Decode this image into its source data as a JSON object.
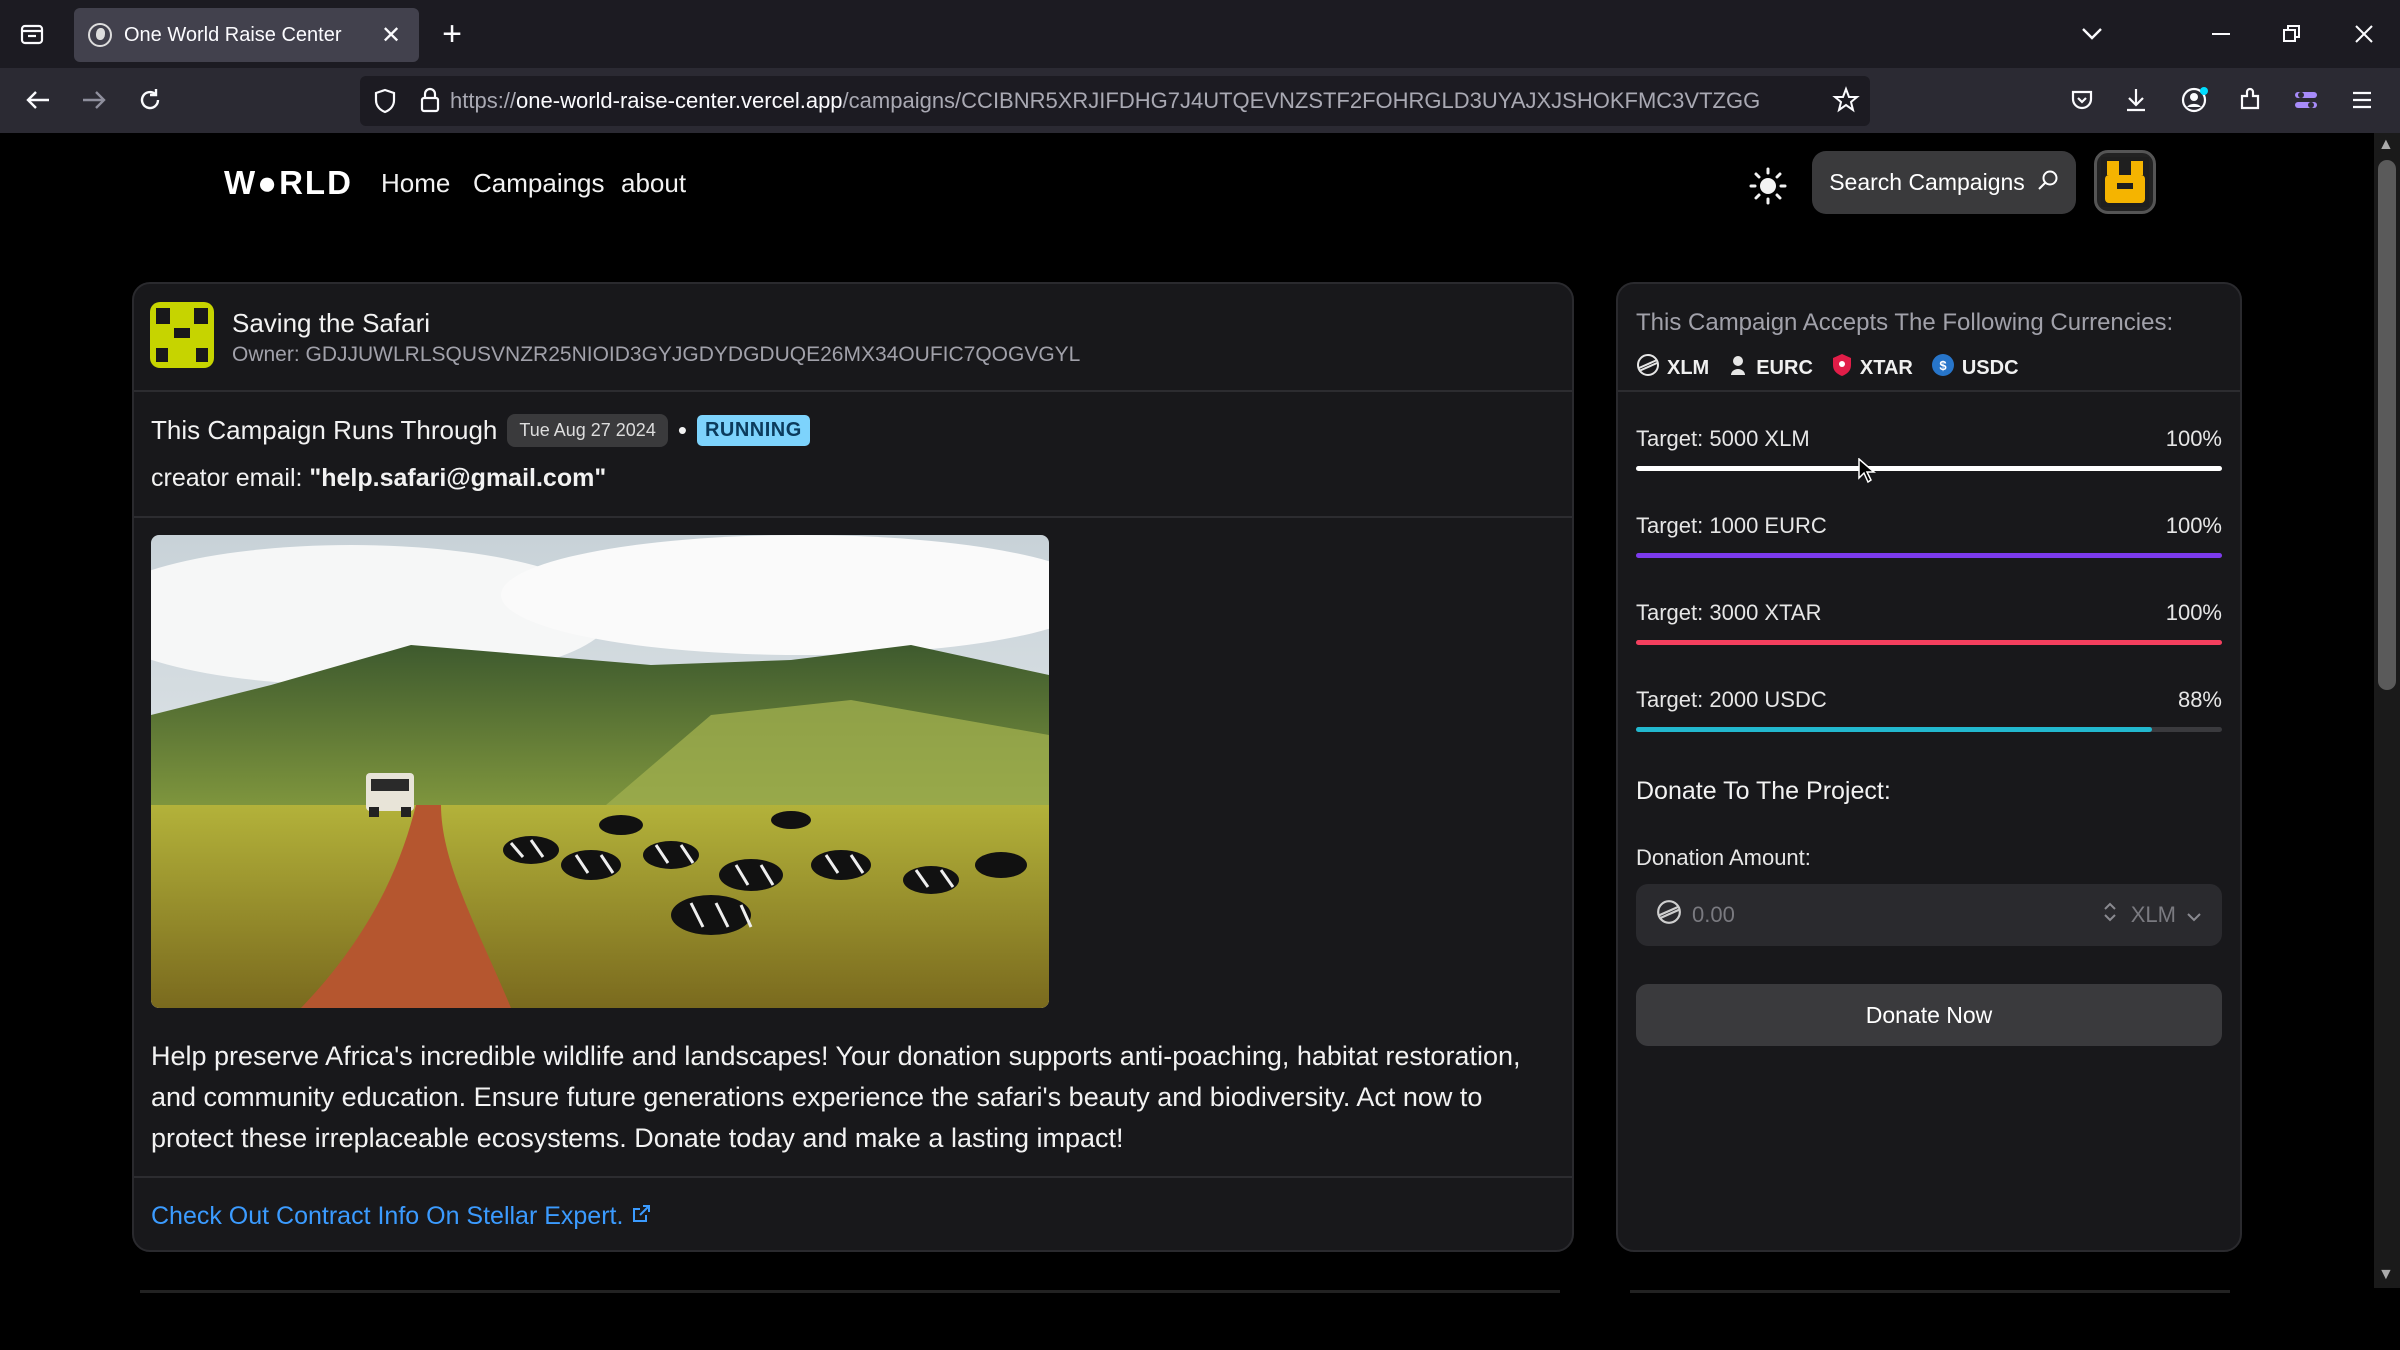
{
  "browser": {
    "tab_title": "One World Raise Center",
    "url_prefix": "https://",
    "url_host": "one-world-raise-center.vercel.app",
    "url_path": "/campaigns/CCIBNR5XRJIFDHG7J4UTQEVNZSTF2FOHRGLD3UYAJXJSHOKFMC3VTZGG",
    "new_tab": "+",
    "close_tab": "✕"
  },
  "nav": {
    "logo": "W●RLD",
    "links": [
      "Home",
      "Campaings",
      "about"
    ],
    "search_label": "Search Campaigns"
  },
  "campaign": {
    "name": "Saving the Safari",
    "owner": "Owner: GDJJUWLRLSQUSVNZR25NIOID3GYJGDYDGDUQE26MX34OUFIC7QOGVGYL",
    "runs_through_label": "This Campaign Runs Through",
    "end_date": "Tue Aug 27 2024",
    "bullet": "•",
    "status": "RUNNING",
    "email_label": "creator email: ",
    "email": "\"help.safari@gmail.com\"",
    "description": "Help preserve Africa's incredible wildlife and landscapes! Your donation supports anti-poaching, habitat restoration, and community education. Ensure future generations experience the safari's beauty and biodiversity. Act now to protect these irreplaceable ecosystems. Donate today and make a lasting impact!",
    "contract_link": "Check Out Contract Info On Stellar Expert."
  },
  "currencies": {
    "heading": "This Campaign Accepts The Following Currencies:",
    "list": [
      {
        "code": "XLM",
        "icon": "stellar-icon",
        "color": "#e6e6e6"
      },
      {
        "code": "EURC",
        "icon": "person-icon",
        "color": "#e6e6e6"
      },
      {
        "code": "XTAR",
        "icon": "shield-icon",
        "color": "#e11d48"
      },
      {
        "code": "USDC",
        "icon": "usdc-icon",
        "color": "#2775ca"
      }
    ]
  },
  "targets": [
    {
      "label": "Target: 5000 XLM",
      "percent_text": "100%",
      "fill": 1.0,
      "color": "#ffffff"
    },
    {
      "label": "Target: 1000 EURC",
      "percent_text": "100%",
      "fill": 1.0,
      "color": "#7c3aed"
    },
    {
      "label": "Target: 3000 XTAR",
      "percent_text": "100%",
      "fill": 1.0,
      "color": "#f43f5e"
    },
    {
      "label": "Target: 2000 USDC",
      "percent_text": "88%",
      "fill": 0.88,
      "color": "#22b8cf"
    }
  ],
  "donate": {
    "heading": "Donate To The Project:",
    "amount_label": "Donation Amount:",
    "amount_placeholder": "0.00",
    "currency": "XLM",
    "button": "Donate Now"
  }
}
